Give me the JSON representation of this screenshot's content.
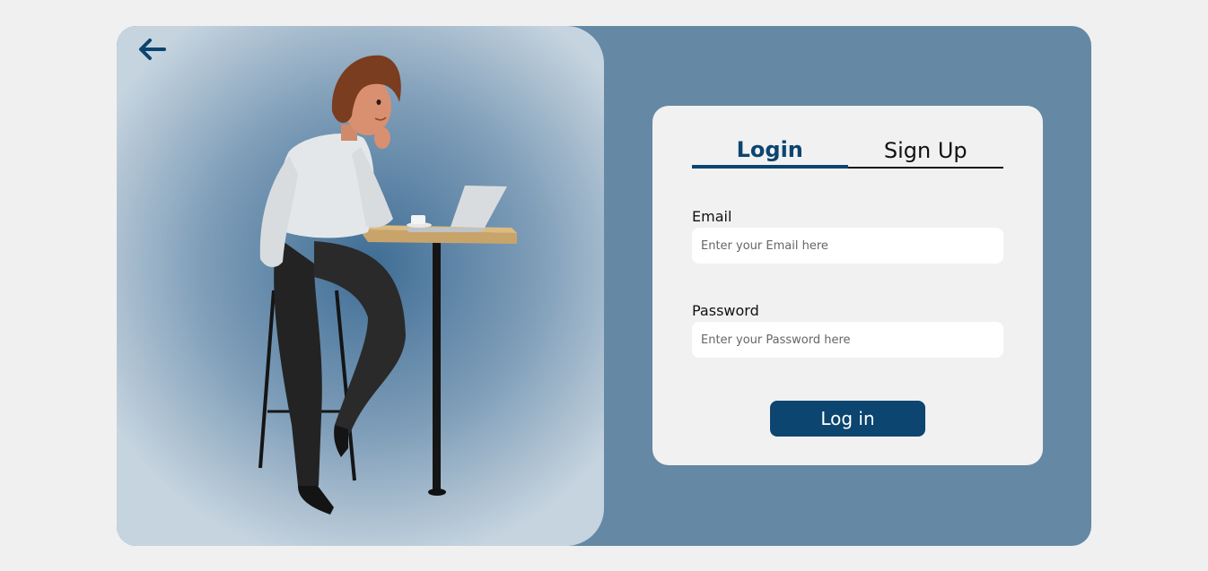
{
  "colors": {
    "page_background": "#f0f0f0",
    "card_background": "#6588a4",
    "accent": "#0b4570",
    "form_background": "#f1f1f1"
  },
  "header": {
    "back_icon": "arrow-left-icon"
  },
  "illustration": {
    "subject": "person-leaning-on-desk-with-laptop"
  },
  "tabs": [
    {
      "label": "Login",
      "active": true
    },
    {
      "label": "Sign Up",
      "active": false
    }
  ],
  "form": {
    "email": {
      "label": "Email",
      "placeholder": "Enter your Email here",
      "value": ""
    },
    "password": {
      "label": "Password",
      "placeholder": "Enter your Password here",
      "value": ""
    },
    "submit_label": "Log in"
  }
}
